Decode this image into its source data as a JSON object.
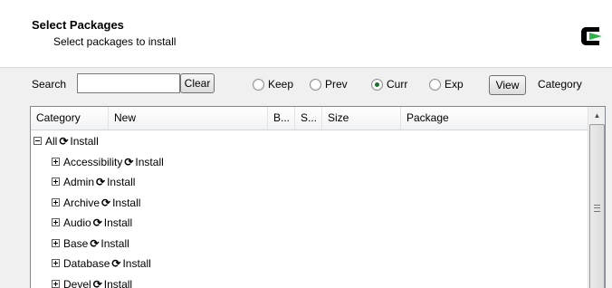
{
  "header": {
    "title": "Select Packages",
    "subtitle": "Select packages to install",
    "logo_icon": "cygwin-logo-icon"
  },
  "toolbar": {
    "search_label": "Search",
    "search_value": "",
    "clear_label": "Clear",
    "radios": [
      {
        "label": "Keep",
        "checked": false
      },
      {
        "label": "Prev",
        "checked": false
      },
      {
        "label": "Curr",
        "checked": true
      },
      {
        "label": "Exp",
        "checked": false
      }
    ],
    "view_label": "View",
    "category_label": "Category"
  },
  "list": {
    "columns": [
      "Category",
      "New",
      "B...",
      "S...",
      "Size",
      "Package"
    ],
    "action_icon": "cycle-arrows-icon",
    "rows": [
      {
        "expander": "minus",
        "name": "All",
        "action": "Install",
        "level": 0
      },
      {
        "expander": "plus",
        "name": "Accessibility",
        "action": "Install",
        "level": 1
      },
      {
        "expander": "plus",
        "name": "Admin",
        "action": "Install",
        "level": 1
      },
      {
        "expander": "plus",
        "name": "Archive",
        "action": "Install",
        "level": 1
      },
      {
        "expander": "plus",
        "name": "Audio",
        "action": "Install",
        "level": 1
      },
      {
        "expander": "plus",
        "name": "Base",
        "action": "Install",
        "level": 1
      },
      {
        "expander": "plus",
        "name": "Database",
        "action": "Install",
        "level": 1
      },
      {
        "expander": "plus",
        "name": "Devel",
        "action": "Install",
        "level": 1
      }
    ]
  },
  "colors": {
    "logo_green": "#2db34a",
    "header_bg": "#ffffff",
    "window_bg": "#f0f0f0"
  }
}
